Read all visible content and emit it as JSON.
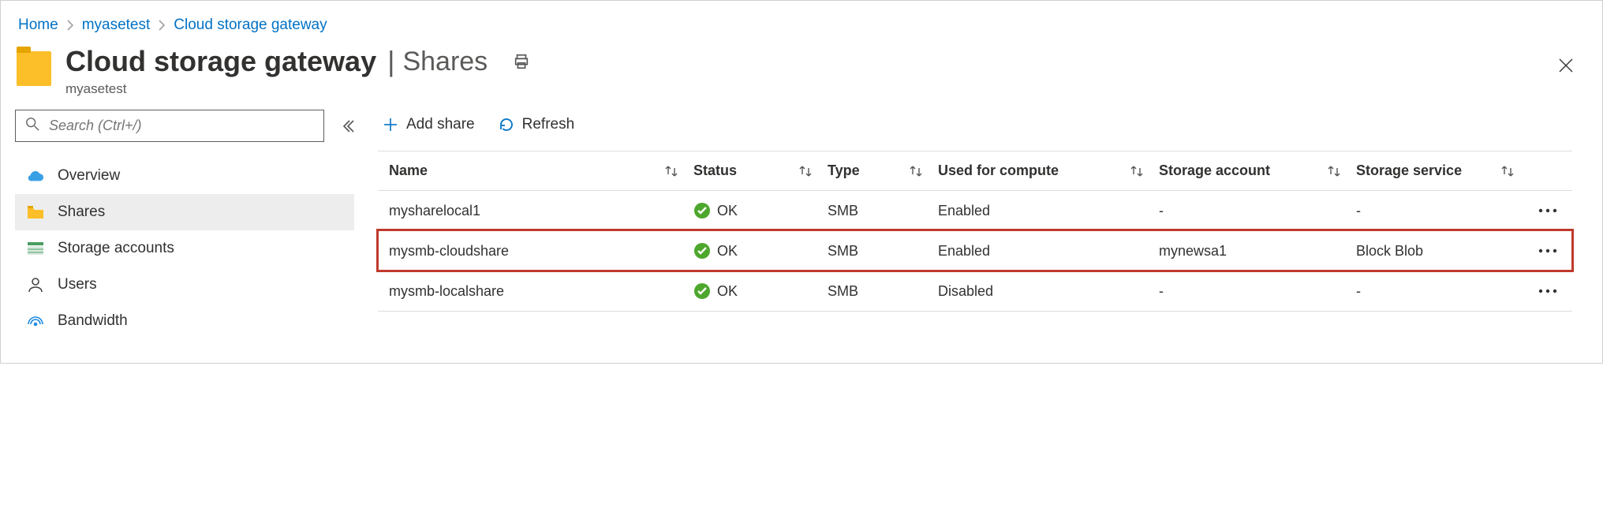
{
  "breadcrumb": {
    "items": [
      "Home",
      "myasetest",
      "Cloud storage gateway"
    ]
  },
  "header": {
    "title": "Cloud storage gateway",
    "section": "Shares",
    "subtitle": "myasetest"
  },
  "search": {
    "placeholder": "Search (Ctrl+/)"
  },
  "nav": {
    "items": [
      {
        "label": "Overview"
      },
      {
        "label": "Shares"
      },
      {
        "label": "Storage accounts"
      },
      {
        "label": "Users"
      },
      {
        "label": "Bandwidth"
      }
    ]
  },
  "toolbar": {
    "add": "Add share",
    "refresh": "Refresh"
  },
  "table": {
    "headers": {
      "name": "Name",
      "status": "Status",
      "type": "Type",
      "compute": "Used for compute",
      "account": "Storage account",
      "service": "Storage service"
    },
    "rows": [
      {
        "name": "mysharelocal1",
        "status": "OK",
        "type": "SMB",
        "compute": "Enabled",
        "account": "-",
        "service": "-"
      },
      {
        "name": "mysmb-cloudshare",
        "status": "OK",
        "type": "SMB",
        "compute": "Enabled",
        "account": "mynewsa1",
        "service": "Block Blob"
      },
      {
        "name": "mysmb-localshare",
        "status": "OK",
        "type": "SMB",
        "compute": "Disabled",
        "account": "-",
        "service": "-"
      }
    ]
  }
}
